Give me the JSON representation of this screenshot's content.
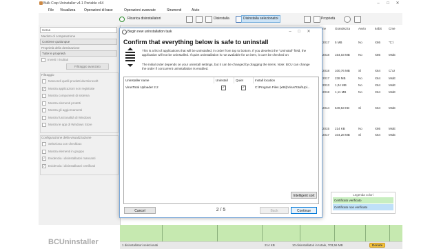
{
  "window": {
    "title": "Bulk Crap Uninstaller v4.1 Portable x64",
    "brand": "BCUninstaller"
  },
  "menu": [
    "File",
    "Visualizza",
    "Operazioni di base",
    "Operazioni avanzate",
    "Strumenti",
    "Aiuto"
  ],
  "toolbar": {
    "refresh": "Ricarica disinstallatori",
    "uninstall": "Disinstalla",
    "uninstall_selected": "Disinstalla selezionatoi",
    "properties": "Proprietà"
  },
  "sidebar": {
    "search_label": "Cerca",
    "compare_label": "Medoto di comparazione",
    "compare_value": "Contiene qualunque",
    "property_label": "Proprietà della destinazione",
    "property_value": "Tutte le proprietà",
    "invert_label": "Inverti i risultati",
    "advanced_filter": "Filtraggio avanzato",
    "filter_group": "Filtraggio",
    "filters": [
      {
        "label": "Nascondi quelli prodotti da Microsoft",
        "checked": false
      },
      {
        "label": "Mostra applicazioni non registrate",
        "checked": true
      },
      {
        "label": "Mostra componenti di sistema",
        "checked": false
      },
      {
        "label": "Mostra elementi protetti",
        "checked": false
      },
      {
        "label": "Mostra gli aggiornamenti",
        "checked": false
      },
      {
        "label": "Mostra funzionalità di Windows",
        "checked": false
      },
      {
        "label": "Mostra le app di Windows Store",
        "checked": false
      }
    ],
    "view_group": "Configurazione della visualizzazione",
    "view_options": [
      {
        "label": "Seleziona con checkbox",
        "checked": false
      },
      {
        "label": "Mostra elementi in gruppo",
        "checked": false
      },
      {
        "label": "Evidenzia i disinstallatori mancanti",
        "checked": true
      },
      {
        "label": "Evidenzia i disinstallatori certificati",
        "checked": true
      }
    ]
  },
  "background_list": {
    "headers": [
      "ne",
      "Grandezza",
      "Avvio",
      "64bit",
      "Cme"
    ],
    "rows": [
      [
        "2017",
        "5 MB",
        "No",
        "X86",
        "\"C:\\"
      ],
      [
        "2018",
        "154,03 MB",
        "No",
        "X86",
        "MsiE"
      ],
      [
        "2018",
        "100,76 MB",
        "Sì",
        "X64",
        "C:\\U"
      ],
      [
        "2017",
        "238 MB",
        "No",
        "X64",
        "MsiE"
      ],
      [
        "2013",
        "1,04 MB",
        "No",
        "X64",
        "MsiE"
      ],
      [
        "2018",
        "1,11 MB",
        "No",
        "X64",
        "MsiE"
      ],
      [
        "2014",
        "549,53 KB",
        "Sì",
        "X64",
        "MsiE"
      ],
      [
        "2015",
        "214 KB",
        "No",
        "X86",
        "MsiE"
      ],
      [
        "2017",
        "104,28 MB",
        "Sì",
        "X64",
        "MsiE"
      ]
    ]
  },
  "legend": {
    "title": "Legenda colori",
    "items": [
      "Certificato verificato",
      "Certificato non verificato"
    ],
    "colors": [
      "#c8eec0",
      "#bfe0f8"
    ]
  },
  "status": {
    "selected": "1 disinstallatori selezionati",
    "size": "214 KB",
    "total": "10 disinstallatori in totale, 703,56 MB",
    "donate": "Donate"
  },
  "dialog": {
    "title": "Begin new uninstallation task",
    "heading": "Confirm that everything below is safe to uninstall",
    "para1": "This is a list of applications that will be uninstalled, in order from top to bottom. If you deselect the \"Uninstall\" field, the application will not be uninstalled. If quiet uninstallation is not available for an item, it can't be checked on",
    "para2": "The initial order depends on your uninstall settings, but it can be changed by dragging the items. Note: BCU can change the order if concurrent uninstallation is enabled.",
    "columns": [
      "Uninstaller name",
      "Uninstall",
      "Quiet",
      "Install location"
    ],
    "rows": [
      {
        "name": "VirusTotal Uploader 2.2",
        "uninstall": true,
        "quiet": true,
        "location": "C:\\Program Files (x86)\\VirusTotal\\Upl..."
      }
    ],
    "intelligent_sort": "Intelligent sort",
    "cancel": "Cancel",
    "pager": "2 / 5",
    "back": "Back",
    "continue": "Continue"
  }
}
